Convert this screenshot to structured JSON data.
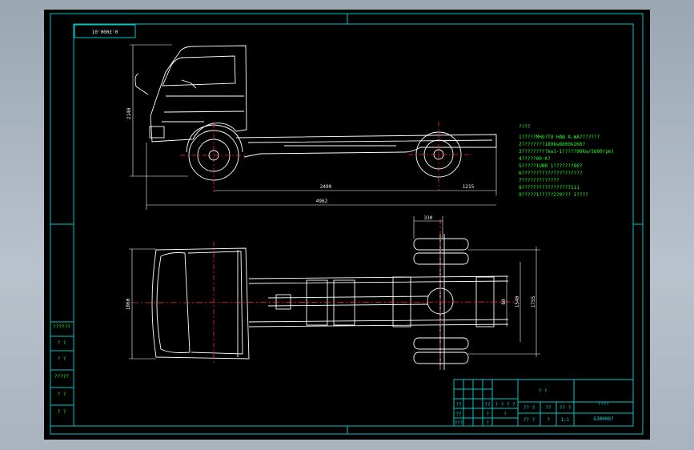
{
  "drawing": {
    "code_stamp": "10'000£'0",
    "notes_title": "????",
    "notes": [
      "1?????MHG?TU HAN A.WA???????",
      "2????????189kw8800k2K6?",
      "3?????????kw1-1(????90kw/3600rpm)",
      "4?????00-K?",
      "5?????1UNR 1???????86?",
      "6?????????????????????",
      "7?????????????",
      "8????????????????7111",
      "9?????1?????2?0??? 1????"
    ],
    "dimensions": {
      "side_height": "2140",
      "wheelbase": "2490",
      "rear_overhang": "1215",
      "overall_length": "4962",
      "top_width": "1860",
      "rear_track": "1540",
      "rear_width": "1755",
      "dual_spacing": "310",
      "small_axle": "80"
    },
    "left_table": [
      "??????",
      "? ?",
      "? ?",
      "?????",
      "? ?",
      "? ?"
    ],
    "title_block": {
      "name": "? ?",
      "school": "??!!",
      "drawing_no": "GJ0000?",
      "cells": [
        "??",
        "??",
        "???",
        "??",
        "? ? ? ?",
        "?",
        "?",
        "?",
        "?? ?",
        "??",
        "?? ?",
        "1:1",
        "?? ?",
        "?",
        "?"
      ]
    }
  }
}
